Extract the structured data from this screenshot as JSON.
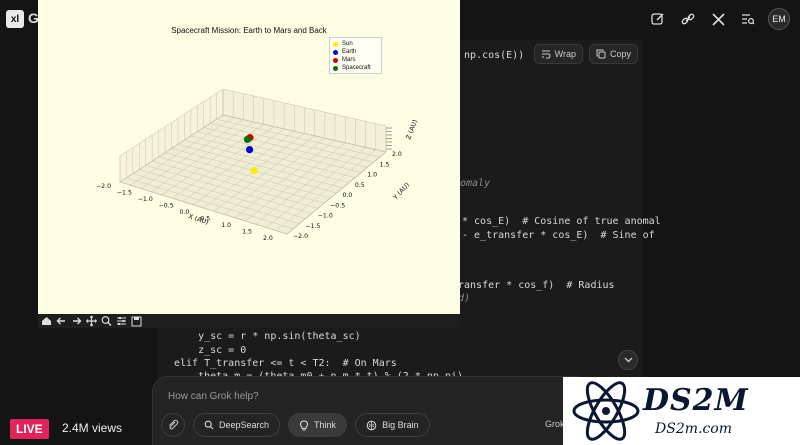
{
  "header": {
    "logo_text": "xl",
    "brand_fragment": "G",
    "avatar_initials": "EM",
    "icons": [
      "edit-icon",
      "link-icon",
      "x-logo-icon",
      "search-list-icon"
    ]
  },
  "code": {
    "wrap_label": "Wrap",
    "copy_label": "Copy",
    "lines": [
      "np.cos(E))",
      "omaly",
      "* cos_E)  # Cosine of true anomal",
      "- e_transfer * cos_E)  # Sine of",
      "ransfer * cos_f)  # Radius",
      "d)",
      "    y_sc = r * np.sin(theta_sc)",
      "    z_sc = 0",
      "elif T_transfer <= t < T2:  # On Mars",
      "    theta_m = (theta_m0 + n_m * t) % (2 * np.pi)"
    ]
  },
  "plot": {
    "title": "Spacecraft Mission: Earth to Mars and Back",
    "toolbar_icons": [
      "home-icon",
      "back-icon",
      "forward-icon",
      "pan-icon",
      "zoom-icon",
      "configure-icon",
      "save-icon"
    ]
  },
  "chart_data": {
    "type": "scatter",
    "projection": "3d",
    "title": "Spacecraft Mission: Earth to Mars and Back",
    "xlabel": "X (AU)",
    "ylabel": "Y (AU)",
    "zlabel": "Z (AU)",
    "xlim": [
      -2.0,
      2.0
    ],
    "ylim": [
      -2.0,
      2.0
    ],
    "x_ticks": [
      "−2.0",
      "−1.5",
      "−1.0",
      "−0.5",
      "0.0",
      "0.5",
      "1.0",
      "1.5",
      "2.0"
    ],
    "y_ticks": [
      "−2.0",
      "−1.5",
      "−1.0",
      "−0.5",
      "0.0",
      "0.5",
      "1.0",
      "1.5",
      "2.0"
    ],
    "grid": true,
    "legend_position": "top-right",
    "series": [
      {
        "name": "Sun",
        "color": "#ffea00",
        "x": 0.0,
        "y": 0.0,
        "z": 0.0
      },
      {
        "name": "Earth",
        "color": "#0000cc",
        "x": -0.6,
        "y": 0.8,
        "z": 0.0
      },
      {
        "name": "Mars",
        "color": "#d40000",
        "x": -0.9,
        "y": 1.3,
        "z": 0.0
      },
      {
        "name": "Spacecraft",
        "color": "#0b6b0b",
        "x": -0.9,
        "y": 1.2,
        "z": 0.0
      }
    ]
  },
  "prompt": {
    "placeholder": "How can Grok help?",
    "buttons": [
      "DeepSearch",
      "Think",
      "Big Brain"
    ],
    "model_fragment": "Grok"
  },
  "watermark": {
    "title": "DS2M",
    "subtitle": "DS2m.com"
  },
  "stream": {
    "live_label": "LIVE",
    "views": "2.4M views"
  }
}
